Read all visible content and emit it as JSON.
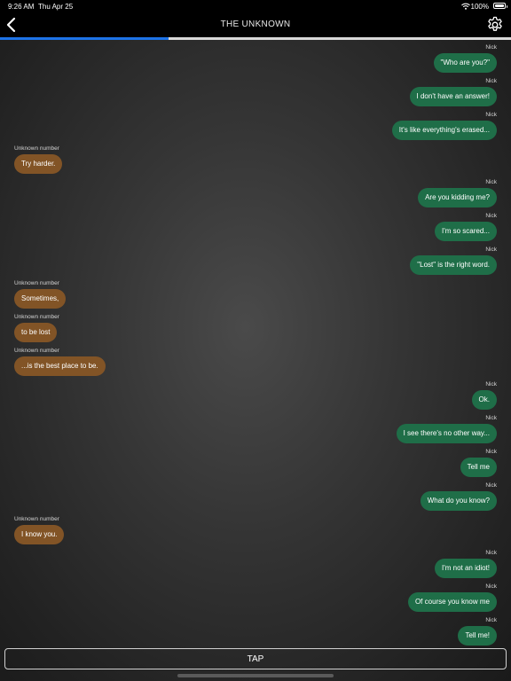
{
  "status_bar": {
    "time": "9:26 AM",
    "date": "Thu Apr 25",
    "battery": "100%",
    "wifi_icon": "wifi-icon",
    "battery_icon": "battery-full-icon"
  },
  "header": {
    "title": "THE UNKNOWN",
    "back_icon": "chevron-left-icon",
    "settings_icon": "gear-icon"
  },
  "progress": {
    "fraction": 0.33,
    "color": "#1d73e8"
  },
  "colors": {
    "outgoing_bubble": "#1f6e48",
    "incoming_bubble": "#825426"
  },
  "messages": [
    {
      "sender": "Nick",
      "text": "\"Who are you?\"",
      "dir": "out"
    },
    {
      "sender": "Nick",
      "text": "I don't have an answer!",
      "dir": "out"
    },
    {
      "sender": "Nick",
      "text": "It's like everything's erased...",
      "dir": "out"
    },
    {
      "sender": "Unknown number",
      "text": "Try harder.",
      "dir": "in"
    },
    {
      "sender": "Nick",
      "text": "Are you kidding me?",
      "dir": "out"
    },
    {
      "sender": "Nick",
      "text": "I'm so scared...",
      "dir": "out"
    },
    {
      "sender": "Nick",
      "text": "\"Lost\" is the right word.",
      "dir": "out"
    },
    {
      "sender": "Unknown number",
      "text": "Sometimes,",
      "dir": "in"
    },
    {
      "sender": "Unknown number",
      "text": "to be lost",
      "dir": "in"
    },
    {
      "sender": "Unknown number",
      "text": "...is the best place to be.",
      "dir": "in"
    },
    {
      "sender": "Nick",
      "text": "Ok.",
      "dir": "out"
    },
    {
      "sender": "Nick",
      "text": "I see there's no other way...",
      "dir": "out"
    },
    {
      "sender": "Nick",
      "text": "Tell me",
      "dir": "out"
    },
    {
      "sender": "Nick",
      "text": "What do you know?",
      "dir": "out"
    },
    {
      "sender": "Unknown number",
      "text": "I know you.",
      "dir": "in"
    },
    {
      "sender": "Nick",
      "text": "I'm not an idiot!",
      "dir": "out"
    },
    {
      "sender": "Nick",
      "text": "Of course you know me",
      "dir": "out"
    },
    {
      "sender": "Nick",
      "text": "Tell me!",
      "dir": "out"
    }
  ],
  "footer": {
    "tap_label": "TAP"
  }
}
